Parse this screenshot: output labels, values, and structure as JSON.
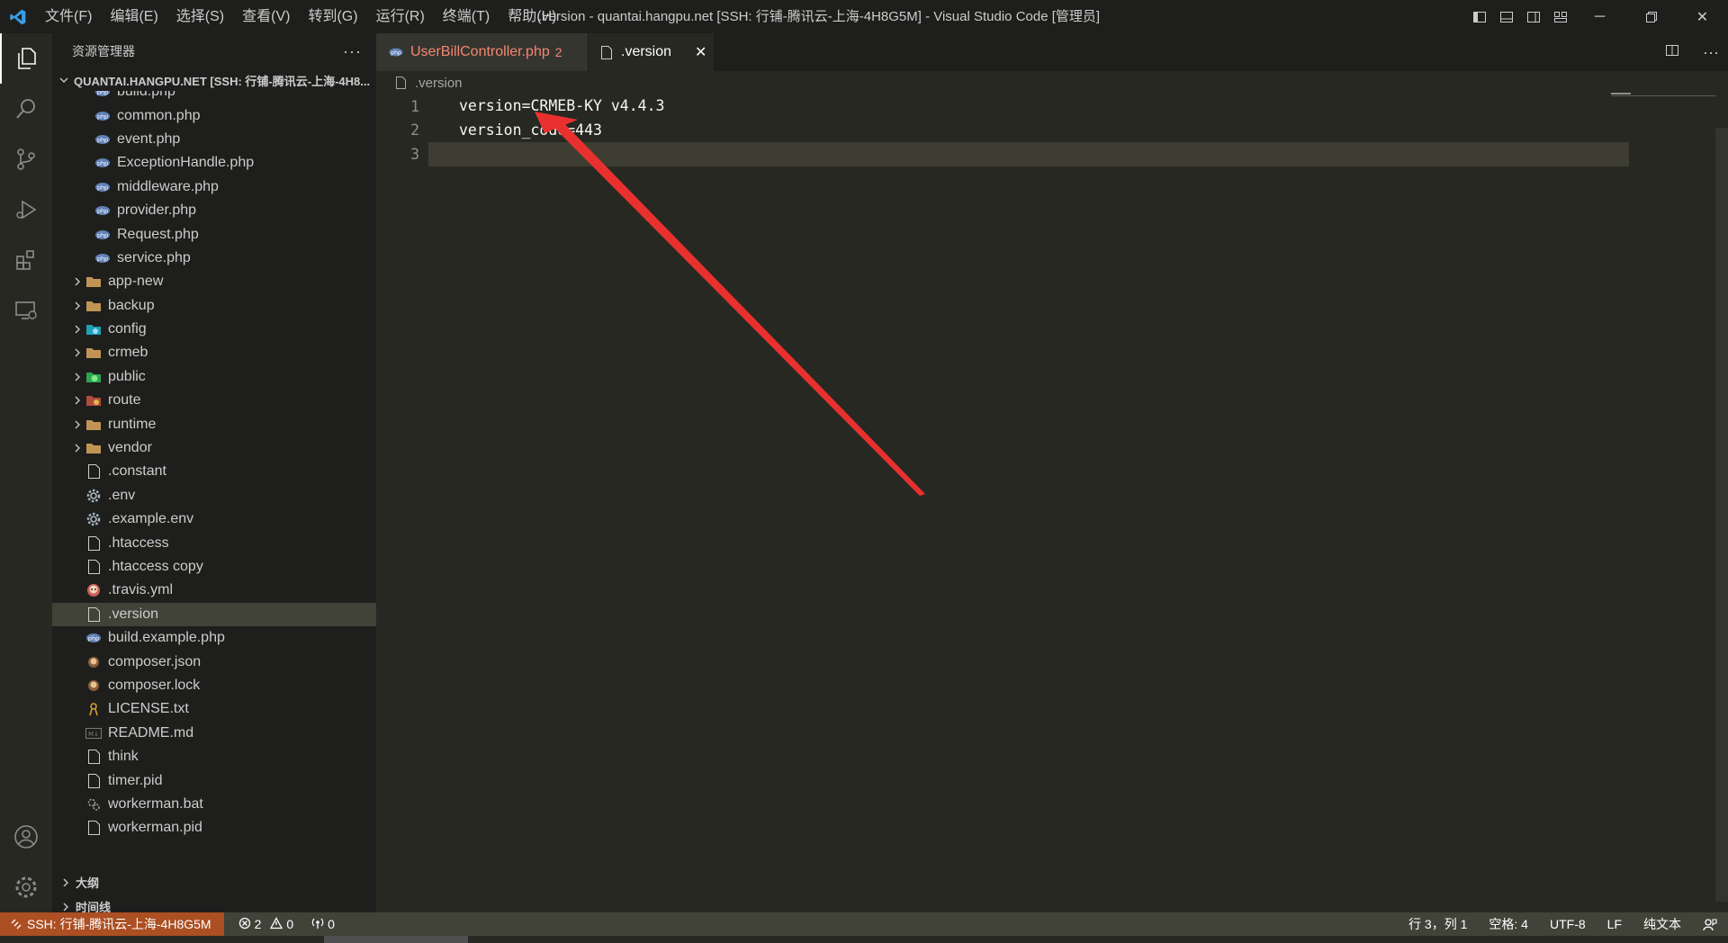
{
  "titlebar": {
    "menu": [
      "文件(F)",
      "编辑(E)",
      "选择(S)",
      "查看(V)",
      "转到(G)",
      "运行(R)",
      "终端(T)",
      "帮助(H)"
    ],
    "window_title": ".version - quantai.hangpu.net [SSH: 行铺-腾讯云-上海-4H8G5M] - Visual Studio Code [管理员]"
  },
  "sidebar": {
    "title": "资源管理器",
    "root_label": "QUANTAI.HANGPU.NET [SSH: 行铺-腾讯云-上海-4H8...",
    "items": [
      {
        "label": "build.php",
        "indent": 2,
        "type": "php"
      },
      {
        "label": "common.php",
        "indent": 2,
        "type": "php"
      },
      {
        "label": "event.php",
        "indent": 2,
        "type": "php"
      },
      {
        "label": "ExceptionHandle.php",
        "indent": 2,
        "type": "php"
      },
      {
        "label": "middleware.php",
        "indent": 2,
        "type": "php"
      },
      {
        "label": "provider.php",
        "indent": 2,
        "type": "php"
      },
      {
        "label": "Request.php",
        "indent": 2,
        "type": "php"
      },
      {
        "label": "service.php",
        "indent": 2,
        "type": "php"
      },
      {
        "label": "app-new",
        "indent": 1,
        "type": "folder"
      },
      {
        "label": "backup",
        "indent": 1,
        "type": "folder"
      },
      {
        "label": "config",
        "indent": 1,
        "type": "folder-config"
      },
      {
        "label": "crmeb",
        "indent": 1,
        "type": "folder"
      },
      {
        "label": "public",
        "indent": 1,
        "type": "folder-public"
      },
      {
        "label": "route",
        "indent": 1,
        "type": "folder-route"
      },
      {
        "label": "runtime",
        "indent": 1,
        "type": "folder"
      },
      {
        "label": "vendor",
        "indent": 1,
        "type": "folder"
      },
      {
        "label": ".constant",
        "indent": 1,
        "type": "file"
      },
      {
        "label": ".env",
        "indent": 1,
        "type": "gear"
      },
      {
        "label": ".example.env",
        "indent": 1,
        "type": "gear"
      },
      {
        "label": ".htaccess",
        "indent": 1,
        "type": "file"
      },
      {
        "label": ".htaccess copy",
        "indent": 1,
        "type": "file"
      },
      {
        "label": ".travis.yml",
        "indent": 1,
        "type": "travis"
      },
      {
        "label": ".version",
        "indent": 1,
        "type": "file",
        "selected": true
      },
      {
        "label": "build.example.php",
        "indent": 1,
        "type": "php"
      },
      {
        "label": "composer.json",
        "indent": 1,
        "type": "composer"
      },
      {
        "label": "composer.lock",
        "indent": 1,
        "type": "composer"
      },
      {
        "label": "LICENSE.txt",
        "indent": 1,
        "type": "license"
      },
      {
        "label": "README.md",
        "indent": 1,
        "type": "md"
      },
      {
        "label": "think",
        "indent": 1,
        "type": "file"
      },
      {
        "label": "timer.pid",
        "indent": 1,
        "type": "file"
      },
      {
        "label": "workerman.bat",
        "indent": 1,
        "type": "bat"
      },
      {
        "label": "workerman.pid",
        "indent": 1,
        "type": "file"
      }
    ],
    "outline_label": "大纲",
    "timeline_label": "时间线"
  },
  "editor": {
    "tabs": [
      {
        "label": "UserBillController.php",
        "badge": "2",
        "active": false
      },
      {
        "label": ".version",
        "active": true
      }
    ],
    "breadcrumb": ".version",
    "lines": [
      {
        "num": "1",
        "text": "version=CRMEB-KY v4.4.3"
      },
      {
        "num": "2",
        "text": "version_code=443"
      },
      {
        "num": "3",
        "text": ""
      }
    ]
  },
  "statusbar": {
    "remote": "SSH: 行铺-腾讯云-上海-4H8G5M",
    "errors": "2",
    "warnings": "0",
    "ports": "0",
    "position": "行 3，列 1",
    "spaces": "空格: 4",
    "encoding": "UTF-8",
    "eol": "LF",
    "language": "纯文本"
  },
  "colors": {
    "accent_remote": "#ac4f22",
    "arrow": "#e8312f",
    "error_tab": "#f48771"
  }
}
